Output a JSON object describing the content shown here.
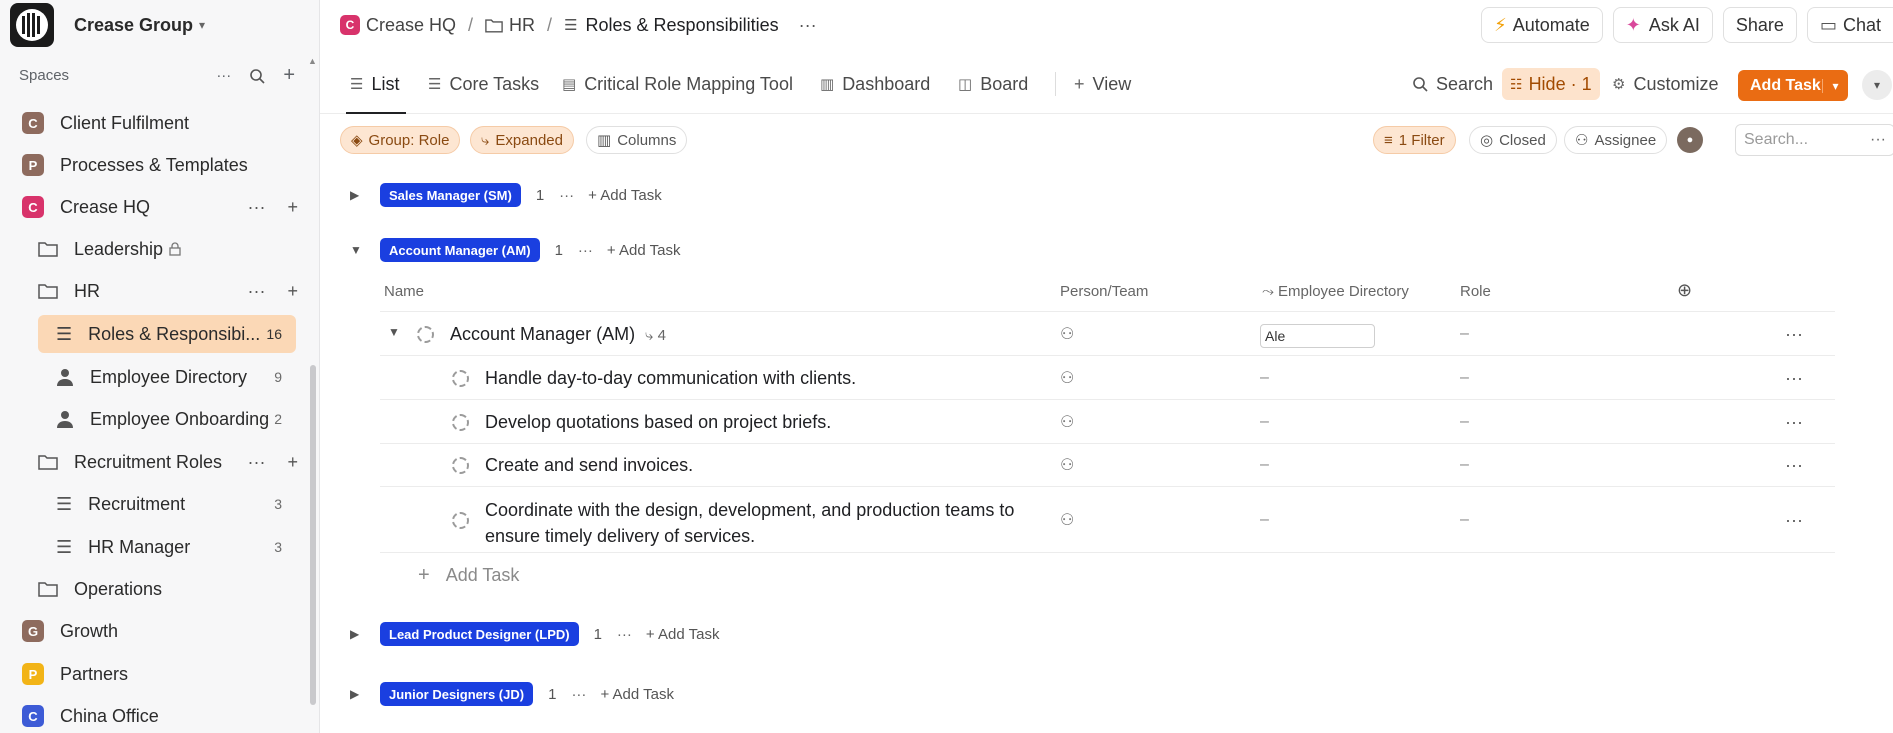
{
  "workspace": {
    "name": "Crease Group"
  },
  "sidebar": {
    "spaces_label": "Spaces",
    "items": [
      {
        "label": "Client Fulfilment",
        "badge": "C",
        "color": "#8e6b5e"
      },
      {
        "label": "Processes & Templates",
        "badge": "P",
        "color": "#8e6b5e"
      },
      {
        "label": "Crease HQ",
        "badge": "C",
        "color": "#d8336b"
      },
      {
        "label": "Leadership"
      },
      {
        "label": "HR"
      },
      {
        "label": "Roles & Responsibi...",
        "count": "16"
      },
      {
        "label": "Employee Directory",
        "count": "9"
      },
      {
        "label": "Employee Onboarding",
        "count": "2"
      },
      {
        "label": "Recruitment Roles"
      },
      {
        "label": "Recruitment",
        "count": "3"
      },
      {
        "label": "HR Manager",
        "count": "3"
      },
      {
        "label": "Operations"
      },
      {
        "label": "Growth",
        "badge": "G",
        "color": "#8e6b5e"
      },
      {
        "label": "Partners",
        "badge": "P",
        "color": "#f2b417"
      },
      {
        "label": "China Office",
        "badge": "C",
        "color": "#3d5bd6"
      }
    ]
  },
  "breadcrumb": {
    "space": "Crease HQ",
    "folder": "HR",
    "list": "Roles & Responsibilities"
  },
  "topbar": {
    "automate": "Automate",
    "ask_ai": "Ask AI",
    "share": "Share",
    "chat": "Chat"
  },
  "views": {
    "tabs": [
      "List",
      "Core Tasks",
      "Critical Role Mapping Tool",
      "Dashboard",
      "Board"
    ],
    "add_view": "View",
    "search": "Search",
    "hide": "Hide · 1",
    "customize": "Customize",
    "add_task": "Add Task"
  },
  "filters": {
    "group": "Group: Role",
    "expanded": "Expanded",
    "columns": "Columns",
    "filter": "1 Filter",
    "closed": "Closed",
    "assignee": "Assignee",
    "search_placeholder": "Search..."
  },
  "groups": [
    {
      "name": "Sales Manager (SM)",
      "count": "1",
      "add": "Add Task"
    },
    {
      "name": "Account Manager (AM)",
      "count": "1",
      "add": "Add Task"
    },
    {
      "name": "Lead Product Designer (LPD)",
      "count": "1",
      "add": "Add Task"
    },
    {
      "name": "Junior Designers (JD)",
      "count": "1",
      "add": "Add Task"
    }
  ],
  "table": {
    "columns": [
      "Name",
      "Person/Team",
      "Employee Directory",
      "Role"
    ],
    "parent": {
      "name": "Account Manager (AM)",
      "subtasks": "4",
      "employee": "Ale",
      "role": "–"
    },
    "rows": [
      {
        "name": "Handle day-to-day communication with clients.",
        "employee": "–",
        "role": "–"
      },
      {
        "name": "Develop quotations based on project briefs.",
        "employee": "–",
        "role": "–"
      },
      {
        "name": "Create and send invoices.",
        "employee": "–",
        "role": "–"
      },
      {
        "name_line1": "Coordinate with the design, development, and production teams to",
        "name_line2": "ensure timely delivery of services.",
        "employee": "–",
        "role": "–"
      }
    ],
    "add_task": "Add Task"
  }
}
